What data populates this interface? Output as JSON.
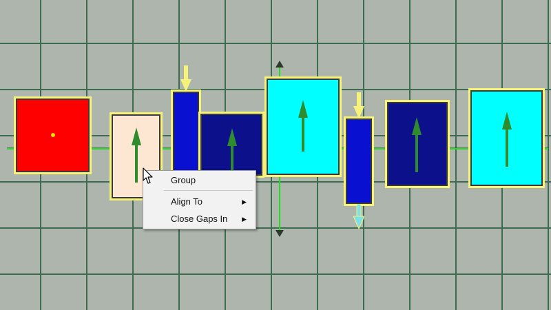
{
  "context_menu": {
    "items": [
      {
        "label": "Group",
        "has_submenu": false
      },
      {
        "label": "Align To",
        "has_submenu": true
      },
      {
        "label": "Close Gaps In",
        "has_submenu": true
      }
    ],
    "submenu_glyph": "▶"
  },
  "shapes": [
    {
      "id": "red-rect",
      "fill": "#ff0000"
    },
    {
      "id": "peach-rect",
      "fill": "#fde6d2"
    },
    {
      "id": "blue-tall-rect-1",
      "fill": "#0a10d0"
    },
    {
      "id": "navy-rect-1",
      "fill": "#0c108a"
    },
    {
      "id": "cyan-rect-1",
      "fill": "#00ffff"
    },
    {
      "id": "blue-tall-rect-2",
      "fill": "#0a10d0"
    },
    {
      "id": "navy-rect-2",
      "fill": "#0c108a"
    },
    {
      "id": "cyan-rect-2",
      "fill": "#00ffff"
    }
  ],
  "colors": {
    "grid_background": "#adb5ad",
    "grid_lines": "#3d6b4f",
    "selection_outline": "#f7f37a",
    "axis_line": "#22dd22",
    "pivot_arrow": "#2e8b2e",
    "menu_background": "#f2f2f2"
  },
  "icons": {
    "cursor": "mouse-pointer-icon",
    "pivot": "up-arrow-icon",
    "handle_top": "yellow-down-arrow-icon",
    "handle_bottom": "cyan-down-arrow-icon"
  }
}
